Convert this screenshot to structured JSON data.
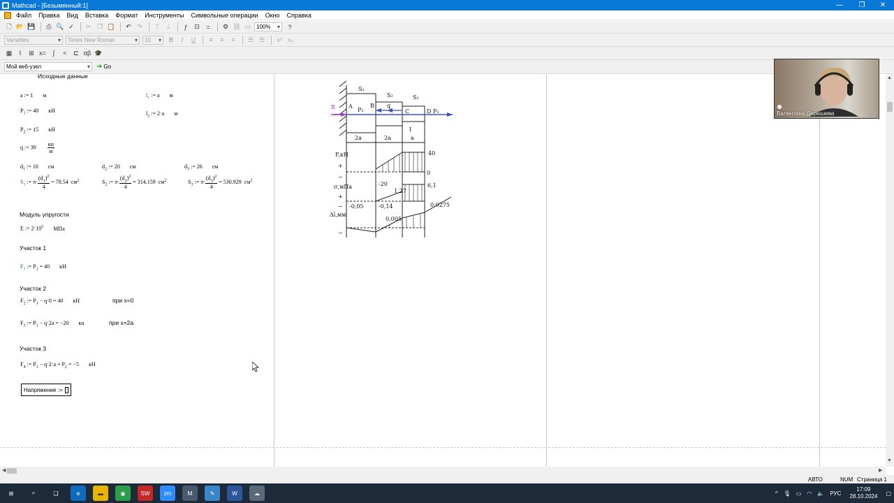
{
  "window": {
    "title": "Mathcad - [Безымянный:1]",
    "minimize": "—",
    "restore": "❐",
    "close": "✕"
  },
  "menu": [
    "Файл",
    "Правка",
    "Вид",
    "Вставка",
    "Формат",
    "Инструменты",
    "Символьные операции",
    "Окно",
    "Справка"
  ],
  "toolbar_format": {
    "style": "Variables",
    "font": "Times New Roman",
    "size": "10",
    "zoom": "100%"
  },
  "web_toolbar": {
    "address": "Мой веб-узел",
    "go": "Go"
  },
  "worksheet": {
    "heading": "Исходные данные",
    "a_def": "a := 1",
    "a_unit": "м",
    "l1_def": "a",
    "l1_unit": "м",
    "l2_def": "2·a",
    "l2_unit": "м",
    "P1_def": "40",
    "P1_unit": "кН",
    "P2_def": "15",
    "P2_unit": "кН",
    "q_def": "q := 30",
    "q_unit_num": "кн",
    "q_unit_den": "м",
    "d1_def": "10",
    "d2_def": "20",
    "d3_def": "26",
    "d_unit": "см",
    "S1_result": "78.54",
    "S2_result": "314.159",
    "S3_result": "530.929",
    "S_unit": "см",
    "four": "4",
    "modulus_label": "Модуль упругости",
    "E_def": "E := 2·10",
    "E_exp": "5",
    "E_unit": "МПа",
    "sec1_label": "Участок 1",
    "F1_expr": "40",
    "F1_unit": "кН",
    "sec2_label": "Участок 2",
    "F2_expr": "− q·0 = 40",
    "F2_unit": "кН",
    "F2_note": "при x=0",
    "F3_expr": "− q·2a = −20",
    "F3_unit": "кн",
    "F3_note": "при x=2a",
    "sec3_label": "Участок 3",
    "F4_expr": "− q·2·a + P",
    "F4_result": "= −5",
    "F4_unit": "кН",
    "stress_input": "Напряжение :="
  },
  "sketch": {
    "S1": "S₁",
    "S2": "S₂",
    "S3": "S₁",
    "P2": "P₂",
    "q": "q",
    "P1": "P₁",
    "A": "A",
    "B": "B",
    "C": "C",
    "D": "D",
    "B_left": "B",
    "len1": "2a",
    "len2": "2a",
    "len3": "a",
    "I": "I",
    "F_label": "F,кН",
    "sigma_label": "σ,мПа",
    "eps_label": "Δl,мм",
    "v40": "40",
    "v0": "0",
    "vm20": "-20",
    "v127": "1,27",
    "v61": "6,1",
    "vm005": "-0,05",
    "vm014": "-0,14",
    "v0005": "0,005",
    "v00275": "0,0275",
    "plus": "+",
    "minus": "−",
    "plus2": "+",
    "minus2": "−",
    "minus3": "−"
  },
  "video": {
    "name": "Валентина Дерюшева"
  },
  "status": {
    "mode": "АВТО",
    "num": "NUM",
    "page": "Страница 1"
  },
  "taskbar": {
    "lang": "РУС",
    "time": "17:09",
    "date": "28.10.2024"
  },
  "colors": {
    "titlebar": "#0a78d7",
    "taskbar": "#1c2a3a",
    "arrow_blue": "#3b4fc4",
    "arrow_purple": "#a43bc4"
  }
}
